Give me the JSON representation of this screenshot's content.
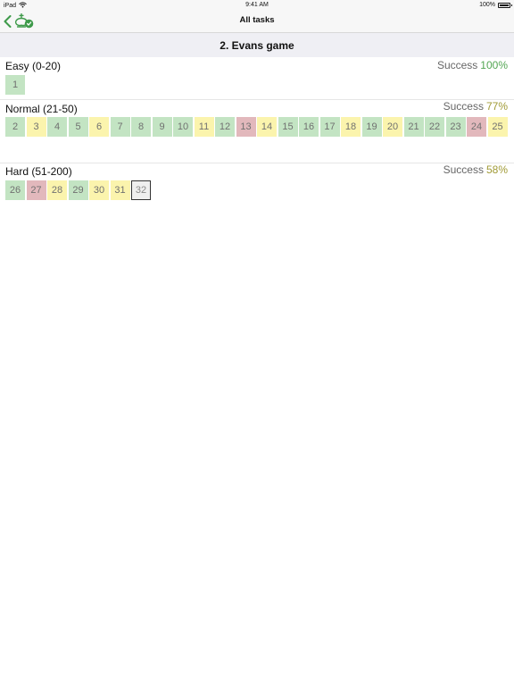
{
  "status_bar": {
    "device": "iPad",
    "time": "9:41 AM",
    "battery": "100%"
  },
  "nav": {
    "title": "All tasks"
  },
  "section_title": "2. Evans game",
  "colors": {
    "green_tile": "#c3e4c3",
    "yellow_tile": "#fbf4ad",
    "red_tile": "#e2b8bc",
    "success_green": "#53a653",
    "success_olive": "#a09a35"
  },
  "groups": [
    {
      "label": "Easy (0-20)",
      "success_label": "Success",
      "success_pct": "100%",
      "pct_color": "#53a653",
      "tiles": [
        {
          "n": "1",
          "s": "green"
        }
      ]
    },
    {
      "label": "Normal (21-50)",
      "success_label": "Success",
      "success_pct": "77%",
      "pct_color": "#a09a35",
      "tiles": [
        {
          "n": "2",
          "s": "green"
        },
        {
          "n": "3",
          "s": "yellow"
        },
        {
          "n": "4",
          "s": "green"
        },
        {
          "n": "5",
          "s": "green"
        },
        {
          "n": "6",
          "s": "yellow"
        },
        {
          "n": "7",
          "s": "green"
        },
        {
          "n": "8",
          "s": "green"
        },
        {
          "n": "9",
          "s": "green"
        },
        {
          "n": "10",
          "s": "green"
        },
        {
          "n": "11",
          "s": "yellow"
        },
        {
          "n": "12",
          "s": "green"
        },
        {
          "n": "13",
          "s": "red"
        },
        {
          "n": "14",
          "s": "yellow"
        },
        {
          "n": "15",
          "s": "green"
        },
        {
          "n": "16",
          "s": "green"
        },
        {
          "n": "17",
          "s": "green"
        },
        {
          "n": "18",
          "s": "yellow"
        },
        {
          "n": "19",
          "s": "green"
        },
        {
          "n": "20",
          "s": "yellow"
        },
        {
          "n": "21",
          "s": "green"
        },
        {
          "n": "22",
          "s": "green"
        },
        {
          "n": "23",
          "s": "green"
        },
        {
          "n": "24",
          "s": "red"
        },
        {
          "n": "25",
          "s": "yellow"
        }
      ]
    },
    {
      "label": "Hard (51-200)",
      "success_label": "Success",
      "success_pct": "58%",
      "pct_color": "#a09a35",
      "tiles": [
        {
          "n": "26",
          "s": "green"
        },
        {
          "n": "27",
          "s": "red"
        },
        {
          "n": "28",
          "s": "yellow"
        },
        {
          "n": "29",
          "s": "green"
        },
        {
          "n": "30",
          "s": "yellow"
        },
        {
          "n": "31",
          "s": "yellow"
        },
        {
          "n": "32",
          "s": "current"
        }
      ]
    }
  ]
}
